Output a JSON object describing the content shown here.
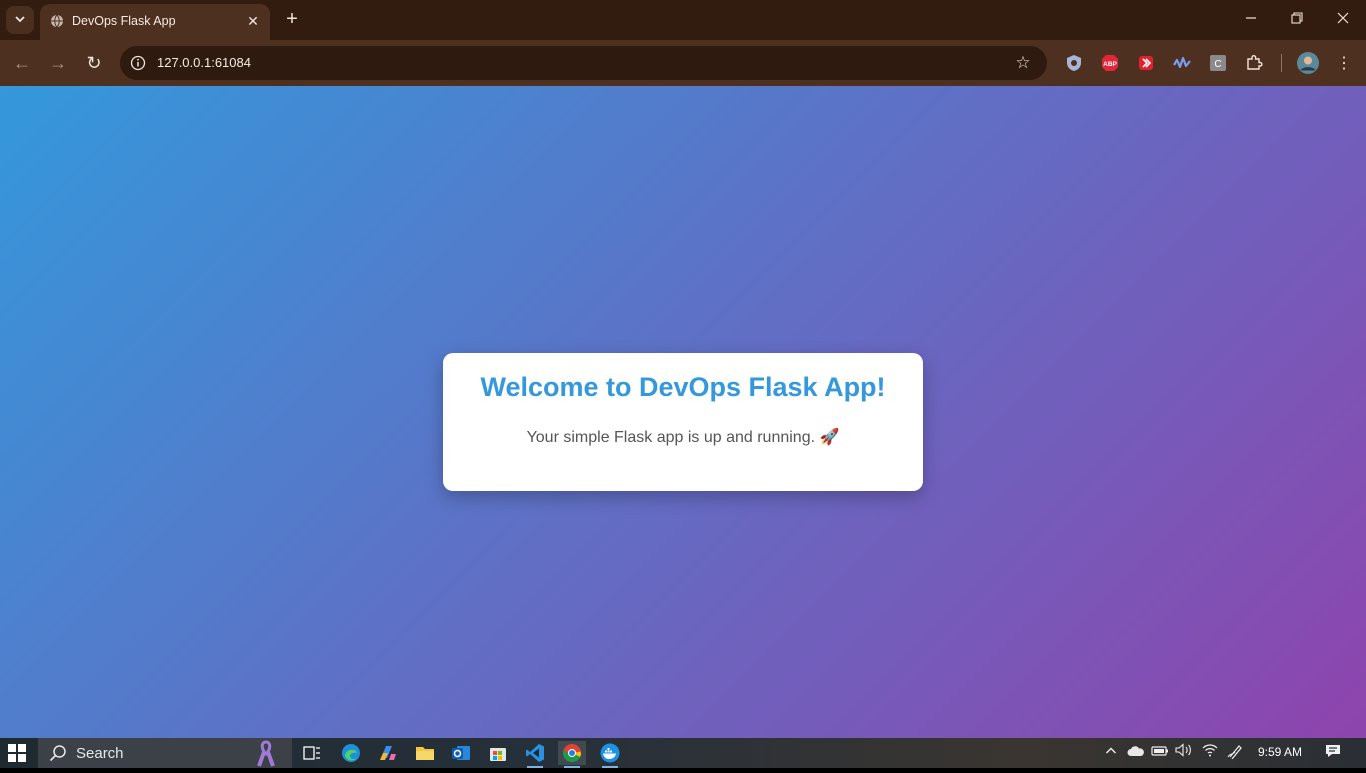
{
  "browser": {
    "tab": {
      "title": "DevOps Flask App",
      "close_glyph": "✕"
    },
    "new_tab_glyph": "+",
    "window_controls": {
      "minimize": "—",
      "restore": "❐",
      "close": "✕"
    },
    "nav": {
      "back": "←",
      "forward": "→",
      "reload": "↻"
    },
    "url": "127.0.0.1:61084",
    "bookmark_glyph": "☆",
    "extensions": [
      "shield-extension",
      "adblock-plus",
      "video-extension",
      "wave-extension",
      "c-extension",
      "extensions-puzzle",
      "profile-avatar",
      "menu"
    ],
    "abp_label": "ABP",
    "c_label": "C",
    "menu_glyph": "⋮"
  },
  "page": {
    "heading": "Welcome to DevOps Flask App!",
    "message": "Your simple Flask app is up and running. 🚀",
    "colors": {
      "gradient_start": "#3498db",
      "gradient_end": "#8e44ad",
      "heading": "#3498db",
      "text": "#555555"
    }
  },
  "taskbar": {
    "search_label": "Search",
    "apps": [
      "ribbon",
      "task-view",
      "edge",
      "copilot",
      "file-explorer",
      "outlook",
      "store",
      "vscode",
      "chrome",
      "docker"
    ],
    "clock": "9:59 AM",
    "tray_chevron": "^"
  }
}
